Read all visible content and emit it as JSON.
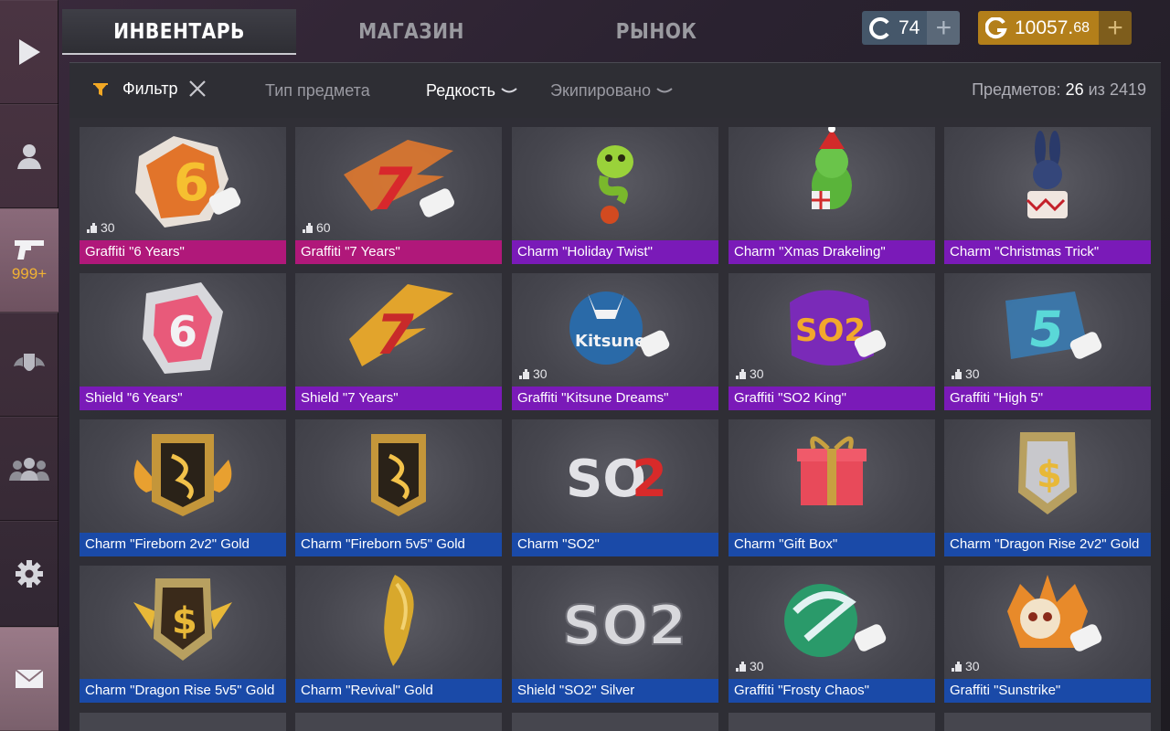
{
  "sidebar": {
    "items": [
      {
        "name": "play",
        "icon": "play-icon"
      },
      {
        "name": "profile",
        "icon": "user-icon"
      },
      {
        "name": "inventory",
        "icon": "pistol-icon",
        "count": "999+"
      },
      {
        "name": "ranks",
        "icon": "wings-shield-icon"
      },
      {
        "name": "clan",
        "icon": "group-icon"
      },
      {
        "name": "settings",
        "icon": "gear-icon"
      },
      {
        "name": "mail",
        "icon": "mail-icon"
      }
    ]
  },
  "tabs": [
    {
      "label": "ИНВЕНТАРЬ",
      "active": true
    },
    {
      "label": "МАГАЗИН",
      "active": false
    },
    {
      "label": "РЫНОК",
      "active": false
    }
  ],
  "currency": {
    "silver": {
      "value": "74",
      "color": "#45576a"
    },
    "gold": {
      "value_main": "10057.",
      "value_dec": "68",
      "color": "#b37f1a"
    }
  },
  "filterbar": {
    "filter_label": "Фильтр",
    "item_type": "Тип предмета",
    "rarity": "Редкость",
    "equipped": "Экипировано",
    "count_label": "Предметов:",
    "count_current": "26",
    "count_sep": "из",
    "count_total": "2419"
  },
  "items": [
    {
      "label": "Graffiti \"6 Years\"",
      "rarity": "pink",
      "uses": "30",
      "art": "graffiti-6"
    },
    {
      "label": "Graffiti \"7 Years\"",
      "rarity": "pink",
      "uses": "60",
      "art": "graffiti-7"
    },
    {
      "label": "Charm \"Holiday Twist\"",
      "rarity": "purple",
      "uses": "",
      "art": "snake"
    },
    {
      "label": "Charm \"Xmas Drakeling\"",
      "rarity": "purple",
      "uses": "",
      "art": "dragon"
    },
    {
      "label": "Charm \"Christmas Trick\"",
      "rarity": "purple",
      "uses": "",
      "art": "bunny"
    },
    {
      "label": "Shield \"6 Years\"",
      "rarity": "purple",
      "uses": "",
      "art": "shield-6"
    },
    {
      "label": "Shield \"7 Years\"",
      "rarity": "purple",
      "uses": "",
      "art": "shield-7"
    },
    {
      "label": "Graffiti \"Kitsune Dreams\"",
      "rarity": "purple",
      "uses": "30",
      "art": "kitsune"
    },
    {
      "label": "Graffiti \"SO2 King\"",
      "rarity": "purple",
      "uses": "30",
      "art": "so2king"
    },
    {
      "label": "Graffiti \"High 5\"",
      "rarity": "purple",
      "uses": "30",
      "art": "high5"
    },
    {
      "label": "Charm \"Fireborn 2v2\" Gold",
      "rarity": "blue",
      "uses": "",
      "art": "fireborn-wide"
    },
    {
      "label": "Charm \"Fireborn 5v5\" Gold",
      "rarity": "blue",
      "uses": "",
      "art": "fireborn"
    },
    {
      "label": "Charm \"SO2\"",
      "rarity": "blue",
      "uses": "",
      "art": "so2-red"
    },
    {
      "label": "Charm \"Gift Box\"",
      "rarity": "blue",
      "uses": "",
      "art": "gift"
    },
    {
      "label": "Charm \"Dragon Rise 2v2\" Gold",
      "rarity": "blue",
      "uses": "",
      "art": "dragonrise"
    },
    {
      "label": "Charm \"Dragon Rise 5v5\" Gold",
      "rarity": "blue",
      "uses": "",
      "art": "dragonrise-wide"
    },
    {
      "label": "Charm \"Revival\" Gold",
      "rarity": "blue",
      "uses": "",
      "art": "revival"
    },
    {
      "label": "Shield \"SO2\" Silver",
      "rarity": "blue",
      "uses": "",
      "art": "so2-silver"
    },
    {
      "label": "Graffiti \"Frosty Chaos\"",
      "rarity": "blue",
      "uses": "30",
      "art": "frosty"
    },
    {
      "label": "Graffiti \"Sunstrike\"",
      "rarity": "blue",
      "uses": "30",
      "art": "sunstrike"
    }
  ]
}
